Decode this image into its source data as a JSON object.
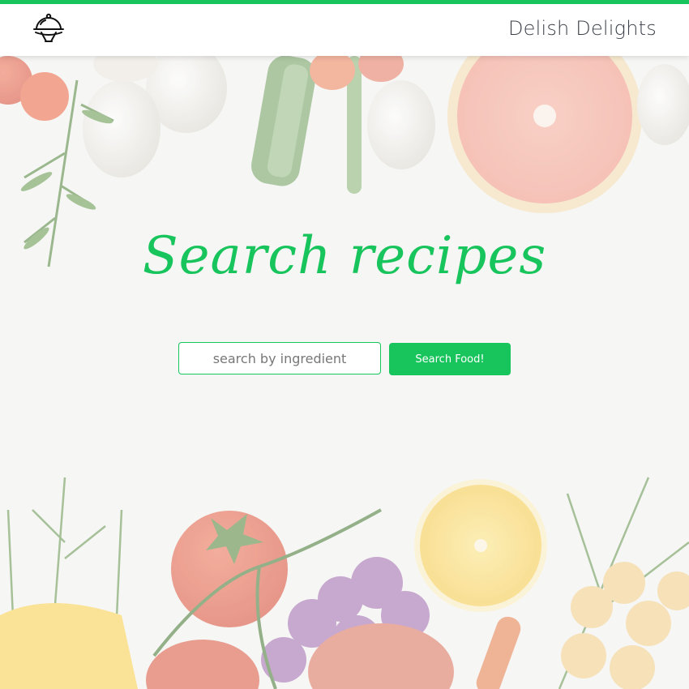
{
  "header": {
    "brand": "Delish Delights",
    "logo_icon": "food-cloche-icon"
  },
  "hero": {
    "title": "Search recipes",
    "search_placeholder": "search by ingredient",
    "search_value": "",
    "search_button_label": "Search Food!"
  },
  "theme": {
    "accent": "#18c45c",
    "text_dark": "#3a3f47",
    "background": "#f6f6f4"
  }
}
